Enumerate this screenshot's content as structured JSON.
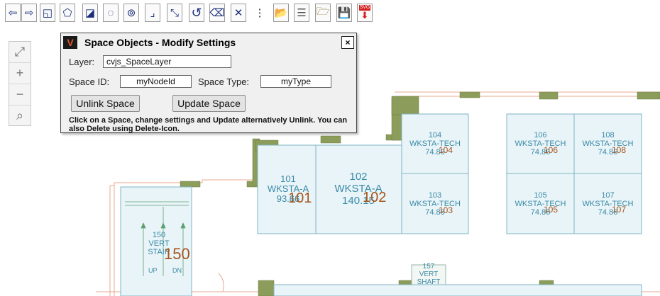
{
  "toolbar": {
    "buttons": [
      {
        "name": "zoom-previous-button",
        "icon": "back-arrow-icon",
        "glyph": "⇦"
      },
      {
        "name": "zoom-next-button",
        "icon": "forward-arrow-icon",
        "glyph": "⇨"
      },
      {
        "name": "add-space-button",
        "icon": "add-rectangle-icon",
        "glyph": "◱"
      },
      {
        "name": "add-polygon-button",
        "icon": "polygon-icon",
        "glyph": "⬠"
      },
      {
        "name": "edit-rectangle-button",
        "icon": "edit-rectangle-icon",
        "glyph": "◪"
      },
      {
        "name": "circle-select-button",
        "icon": "circle-icon",
        "glyph": "◌"
      },
      {
        "name": "multi-circle-button",
        "icon": "double-circle-icon",
        "glyph": "⊚"
      },
      {
        "name": "move-button",
        "icon": "move-corner-icon",
        "glyph": "⌟"
      },
      {
        "name": "resize-button",
        "icon": "resize-icon",
        "glyph": "⤡"
      },
      {
        "name": "rotate-button",
        "icon": "rotate-icon",
        "glyph": "↺"
      },
      {
        "name": "erase-button",
        "icon": "eraser-icon",
        "glyph": "⌫"
      },
      {
        "name": "delete-button",
        "icon": "close-x-icon",
        "glyph": "✕"
      },
      {
        "name": "more-button",
        "icon": "vertical-dots-icon",
        "glyph": "⋮"
      },
      {
        "name": "open-folder-button",
        "icon": "folder-open-icon",
        "glyph": "📂"
      },
      {
        "name": "layers-button",
        "icon": "layers-icon",
        "glyph": "☰"
      },
      {
        "name": "open-file-button",
        "icon": "folder-icon",
        "glyph": "🗁"
      },
      {
        "name": "save-button",
        "icon": "floppy-disk-icon",
        "glyph": "💾"
      },
      {
        "name": "svg-export-button",
        "icon": "svg-download-icon",
        "glyph": "⬇"
      }
    ],
    "svg_badge": "SVG"
  },
  "zoom_controls": {
    "fit": "⤢",
    "zoom_in": "+",
    "zoom_out": "−",
    "zoom_window": "⌕"
  },
  "dialog": {
    "title": "Space Objects - Modify Settings",
    "close": "×",
    "layer_label": "Layer:",
    "layer_value": "cvjs_SpaceLayer",
    "space_id_label": "Space ID:",
    "space_id_value": "myNodeId",
    "space_type_label": "Space Type:",
    "space_type_value": "myType",
    "unlink_button": "Unlink Space",
    "update_button": "Update Space",
    "help_text": "Click on a Space, change settings and Update alternatively Unlink. You can also Delete using Delete-Icon."
  },
  "rooms": [
    {
      "id": "101",
      "type": "WKSTA-A",
      "area": "93.66",
      "tag": "101"
    },
    {
      "id": "102",
      "type": "WKSTA-A",
      "area": "140.15",
      "tag": "102"
    },
    {
      "id": "103",
      "type": "WKSTA-TECH",
      "area": "74.86",
      "tag": "103"
    },
    {
      "id": "104",
      "type": "WKSTA-TECH",
      "area": "74.86",
      "tag": "104"
    },
    {
      "id": "105",
      "type": "WKSTA-TECH",
      "area": "74.86",
      "tag": "105"
    },
    {
      "id": "106",
      "type": "WKSTA-TECH",
      "area": "74.86",
      "tag": "106"
    },
    {
      "id": "107",
      "type": "WKSTA-TECH",
      "area": "74.86",
      "tag": "107"
    },
    {
      "id": "108",
      "type": "WKSTA-TECH",
      "area": "74.86",
      "tag": "108"
    },
    {
      "id": "150",
      "type": "VERT",
      "type2": "STAIR",
      "tag": "150",
      "up": "UP",
      "dn": "DN"
    },
    {
      "id": "157",
      "type": "VERT",
      "type2": "SHAFT"
    }
  ],
  "colors": {
    "room_fill": "#e9f4f8",
    "room_stroke": "#7fb4c4",
    "room_text": "#3a8aa6",
    "tag_text": "#a5541b",
    "wall_fill": "#8c9c5a",
    "wall_outline": "#e8a88f"
  }
}
